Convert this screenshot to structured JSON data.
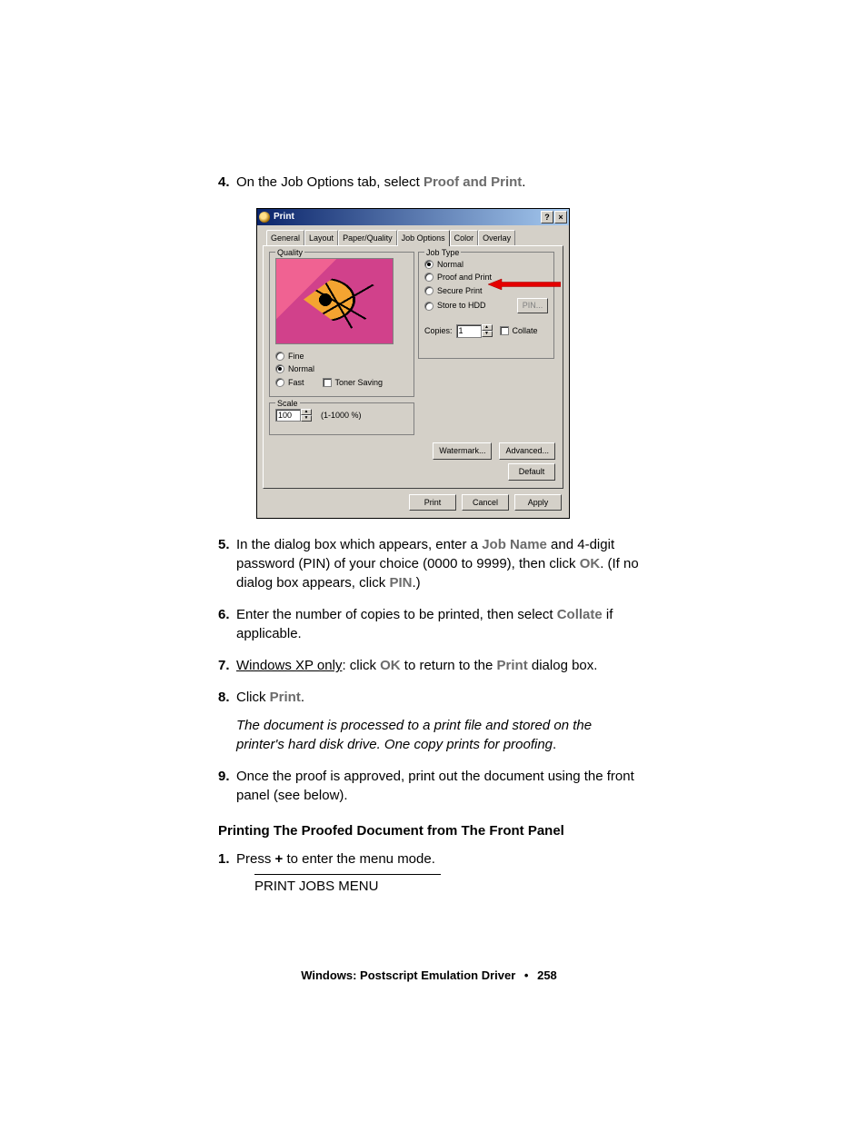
{
  "step4": {
    "prefix": "On the Job Options tab, select ",
    "proof": "Proof and Print",
    "suffix": "."
  },
  "dialog": {
    "title": "Print",
    "tabs": [
      "General",
      "Layout",
      "Paper/Quality",
      "Job Options",
      "Color",
      "Overlay"
    ],
    "active_tab": "Job Options",
    "quality": {
      "legend": "Quality",
      "fine": "Fine",
      "normal": "Normal",
      "fast": "Fast",
      "toner": "Toner Saving"
    },
    "scale": {
      "legend": "Scale",
      "value": "100",
      "range": "(1-1000 %)"
    },
    "jobtype": {
      "legend": "Job Type",
      "normal": "Normal",
      "proof": "Proof and Print",
      "secure": "Secure Print",
      "store": "Store to HDD",
      "pin": "PIN...",
      "copies_label": "Copies:",
      "copies_value": "1",
      "collate": "Collate"
    },
    "buttons": {
      "watermark": "Watermark...",
      "advanced": "Advanced...",
      "default": "Default",
      "print": "Print",
      "cancel": "Cancel",
      "apply": "Apply"
    }
  },
  "step5": {
    "a": "In the dialog box which appears, enter a ",
    "jobname": "Job Name",
    "b": " and 4-digit password (PIN) of your choice (0000 to 9999), then click ",
    "ok": "OK",
    "c": ". (If no dialog box appears, click ",
    "pin": "PIN",
    "d": ".)"
  },
  "step6": {
    "a": "Enter the number of copies to be printed, then select ",
    "collate": "Collate",
    "b": " if applicable."
  },
  "step7": {
    "u": "Windows XP only",
    "a": ": click ",
    "ok": "OK",
    "b": " to return to the ",
    "print": "Print",
    "c": " dialog box."
  },
  "step8": {
    "a": "Click ",
    "print": "Print",
    "b": "."
  },
  "step8italic": "The document is processed to a print file and stored on the printer's hard disk drive. One copy prints for proofing",
  "step8italic_suffix": ".",
  "step9": "Once the proof is approved, print out the document using the front panel (see below).",
  "section2": "Printing The Proofed Document from The Front Panel",
  "sec2step1": {
    "a": "Press ",
    "plus": "+",
    "b": " to enter the menu mode."
  },
  "menu_line": "PRINT JOBS MENU",
  "footer": {
    "left": "Windows: Postscript Emulation Driver",
    "dot": "•",
    "page": "258"
  }
}
